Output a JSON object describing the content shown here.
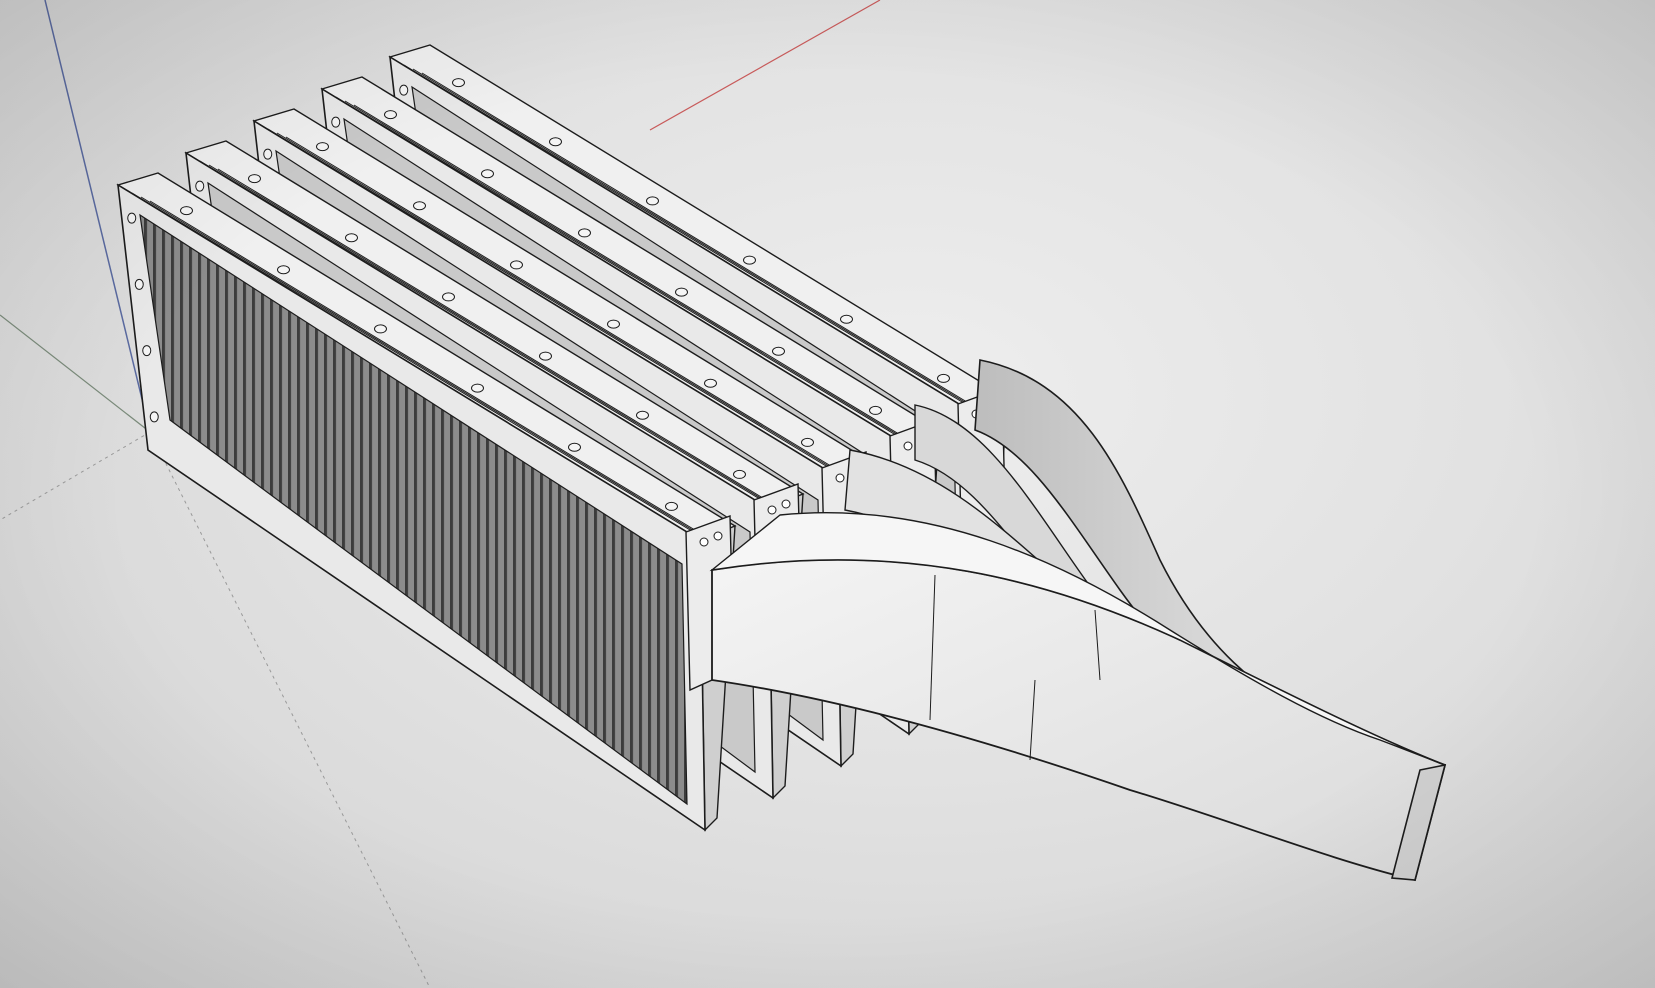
{
  "viewport": {
    "background_color": "#e4e4e4",
    "axis_colors": {
      "red_axis": "#c85a5a",
      "blue_axis": "#5a6aa0",
      "green_axis": "#7a9a7a"
    }
  },
  "model": {
    "panel_count": 5,
    "panel_face_color": "#d6d6d6",
    "panel_frame_color": "#e9e9e9",
    "fin_color": "#6f6f6f",
    "manifold_color": "#f1f1f1",
    "edge_color": "#1c1c1c"
  }
}
